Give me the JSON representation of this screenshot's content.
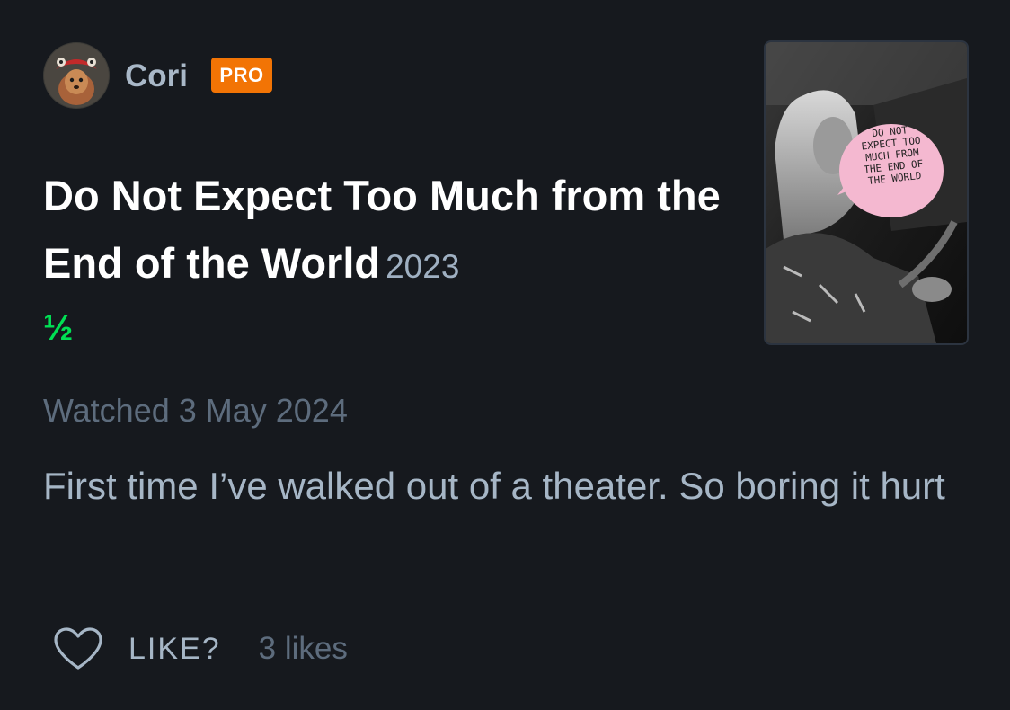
{
  "user": {
    "name": "Cori",
    "badge": "PRO"
  },
  "film": {
    "title": "Do Not Expect Too Much from the End of the World",
    "year": "2023",
    "rating": "½",
    "poster_text": [
      "DO NOT",
      "EXPECT TOO",
      "MUCH FROM",
      "THE END OF",
      "THE WORLD"
    ]
  },
  "review": {
    "watched": "Watched 3 May 2024",
    "text": "First time I’ve walked out of a theater. So boring it hurt"
  },
  "actions": {
    "like_label": "LIKE?",
    "likes_count": "3 likes"
  },
  "colors": {
    "background": "#16191e",
    "pro_badge": "#f27405",
    "rating_green": "#00e054",
    "muted_text": "#5d6c7d",
    "body_text": "#a6b6c6"
  },
  "icons": {
    "like": "heart-icon"
  }
}
